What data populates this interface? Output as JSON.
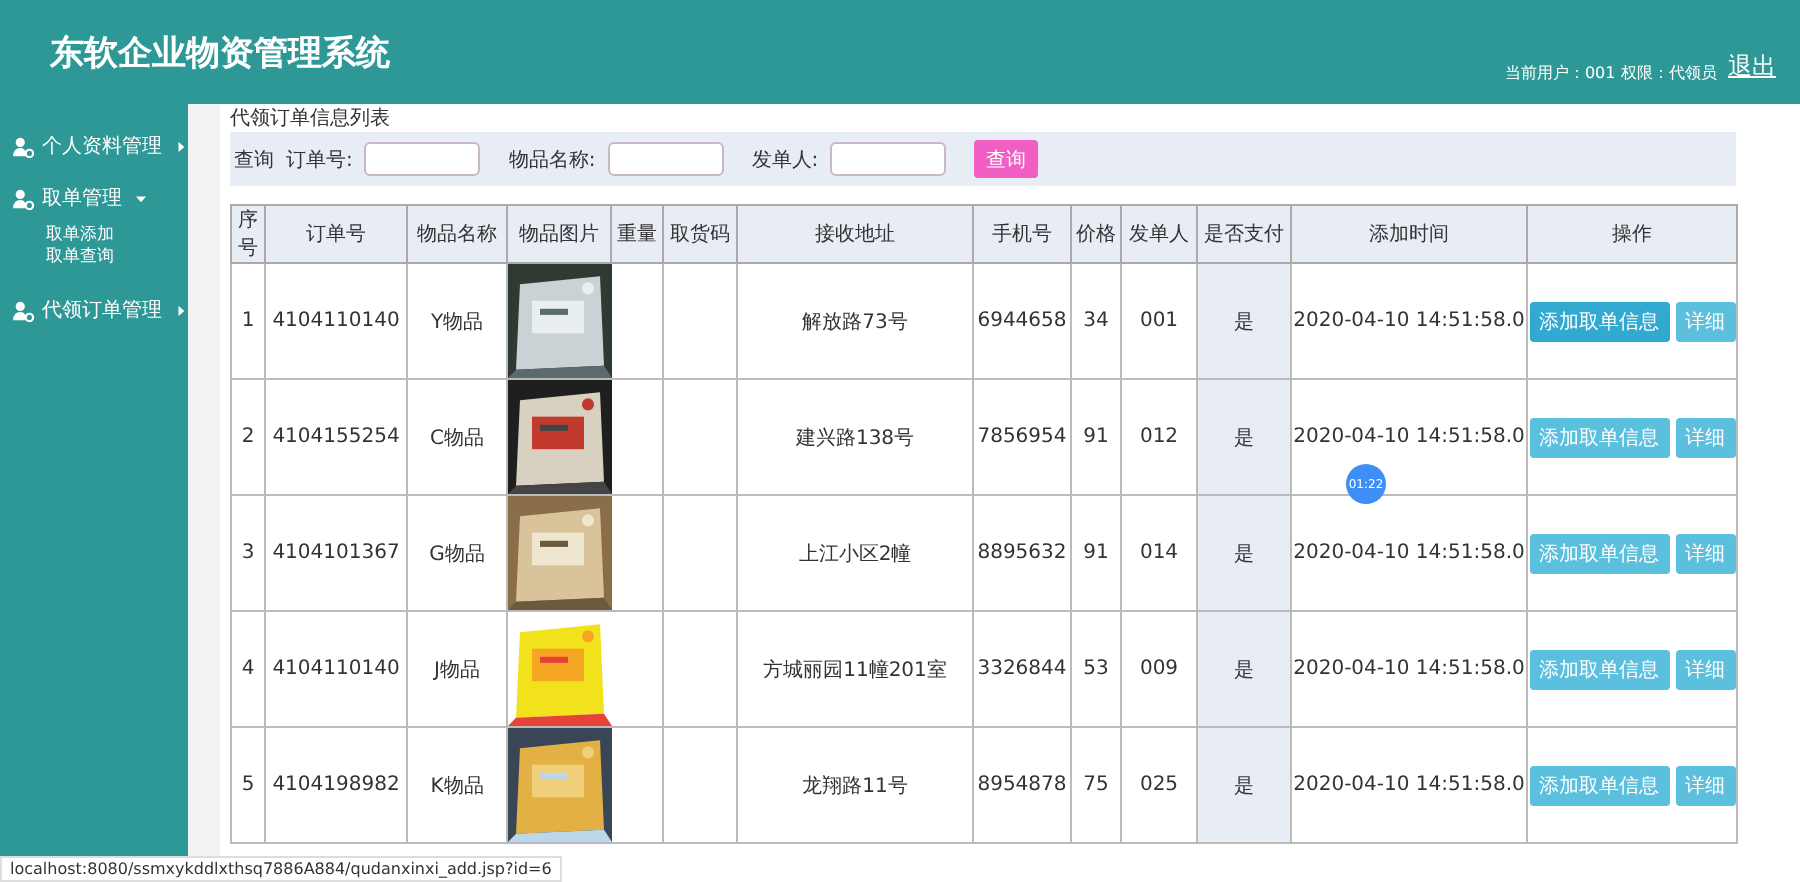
{
  "header": {
    "title": "东软企业物资管理系统",
    "user_info": "当前用户：001 权限：代领员",
    "logout": "退出"
  },
  "sidebar": {
    "items": [
      {
        "label": "个人资料管理",
        "expanded": false
      },
      {
        "label": "取单管理",
        "expanded": true,
        "children": [
          {
            "label": "取单添加"
          },
          {
            "label": "取单查询"
          }
        ]
      },
      {
        "label": "代领订单管理",
        "expanded": false
      }
    ]
  },
  "page_title": "代领订单信息列表",
  "search": {
    "prefix": "查询",
    "fields": [
      {
        "label": "订单号:"
      },
      {
        "label": "物品名称:"
      },
      {
        "label": "发单人:"
      }
    ],
    "button": "查询"
  },
  "table": {
    "columns": [
      "序号",
      "订单号",
      "物品名称",
      "物品图片",
      "重量",
      "取货码",
      "接收地址",
      "手机号",
      "价格",
      "发单人",
      "是否支付",
      "添加时间",
      "操作"
    ],
    "rows": [
      {
        "index": "1",
        "order_no": "4104110140",
        "item": "Y物品",
        "image": {
          "kind": "picture"
        },
        "address": "解放路73号",
        "phone": "6944658",
        "price": "34",
        "sender": "001",
        "paid": "是",
        "time": "2020-04-10 14:51:58.0",
        "actions": [
          {
            "label": "添加取单信息",
            "hovered": true
          },
          {
            "label": "详细",
            "hovered": false
          }
        ]
      },
      {
        "index": "2",
        "order_no": "4104155254",
        "item": "C物品",
        "image": {
          "kind": "picture"
        },
        "address": "建兴路138号",
        "phone": "7856954",
        "price": "91",
        "sender": "012",
        "paid": "是",
        "time": "2020-04-10 14:51:58.0",
        "actions": [
          {
            "label": "添加取单信息",
            "hovered": false
          },
          {
            "label": "详细",
            "hovered": false
          }
        ]
      },
      {
        "index": "3",
        "order_no": "4104101367",
        "item": "G物品",
        "image": {
          "kind": "picture"
        },
        "address": "上江小区2幢",
        "phone": "8895632",
        "price": "91",
        "sender": "014",
        "paid": "是",
        "time": "2020-04-10 14:51:58.0",
        "actions": [
          {
            "label": "添加取单信息",
            "hovered": false
          },
          {
            "label": "详细",
            "hovered": false
          }
        ]
      },
      {
        "index": "4",
        "order_no": "4104110140",
        "item": "J物品",
        "image": {
          "kind": "picture"
        },
        "address": "方城丽园11幢201室",
        "phone": "3326844",
        "price": "53",
        "sender": "009",
        "paid": "是",
        "time": "2020-04-10 14:51:58.0",
        "actions": [
          {
            "label": "添加取单信息",
            "hovered": false
          },
          {
            "label": "详细",
            "hovered": false
          }
        ]
      },
      {
        "index": "5",
        "order_no": "4104198982",
        "item": "K物品",
        "image": {
          "kind": "picture"
        },
        "address": "龙翔路11号",
        "phone": "8954878",
        "price": "75",
        "sender": "025",
        "paid": "是",
        "time": "2020-04-10 14:51:58.0",
        "actions": [
          {
            "label": "添加取单信息",
            "hovered": false
          },
          {
            "label": "详细",
            "hovered": false
          }
        ]
      }
    ]
  },
  "recording_badge": "01:22",
  "status_bar": "localhost:8080/ssmxykddlxthsq7886A884/qudanxinxi_add.jsp?id=6"
}
